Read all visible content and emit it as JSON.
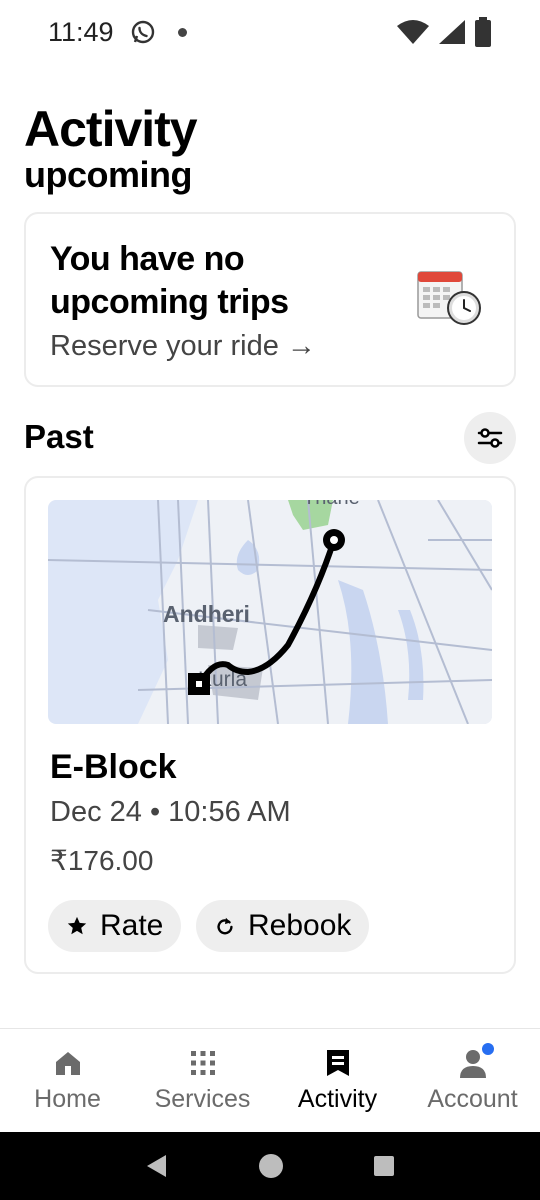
{
  "status_bar": {
    "time": "11:49"
  },
  "page": {
    "title": "Activity",
    "subtitle": "upcoming"
  },
  "upcoming": {
    "title": "You have no upcoming trips",
    "link_label": "Reserve your ride",
    "link_arrow": "→",
    "illustration": "calendar-clock"
  },
  "past": {
    "title": "Past",
    "filter_icon": "sliders-icon"
  },
  "map": {
    "labels": {
      "top": "Thane",
      "mid": "Andheri",
      "bottom": "Kurla"
    }
  },
  "trip": {
    "destination": "E-Block",
    "datetime": "Dec 24 • 10:56 AM",
    "fare": "₹176.00",
    "actions": {
      "rate": "Rate",
      "rebook": "Rebook"
    }
  },
  "bottom_nav": {
    "items": [
      {
        "label": "Home",
        "icon": "home-icon"
      },
      {
        "label": "Services",
        "icon": "grid-icon"
      },
      {
        "label": "Activity",
        "icon": "receipt-icon",
        "active": true
      },
      {
        "label": "Account",
        "icon": "person-icon",
        "notification": true
      }
    ]
  },
  "colors": {
    "accent_blue": "#276ef1",
    "chip_bg": "#eeeeee",
    "map_water": "#dde6f7"
  }
}
